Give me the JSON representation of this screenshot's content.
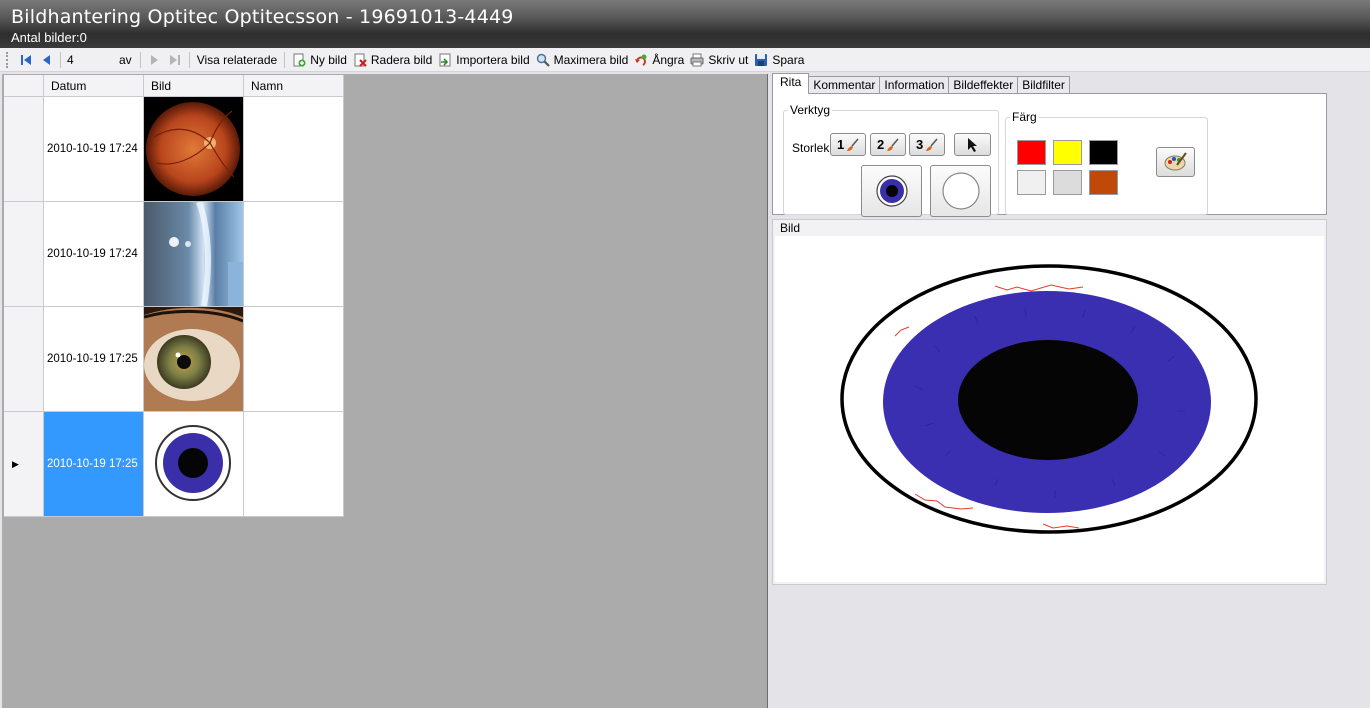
{
  "window": {
    "title": "Bildhantering Optitec Optitecsson - 19691013-4449",
    "subtitle": "Antal bilder:0"
  },
  "toolbar": {
    "position_value": "4",
    "of_label": "av",
    "show_related": "Visa relaterade",
    "new_image": "Ny bild",
    "delete_image": "Radera bild",
    "import_image": "Importera bild",
    "maximize_image": "Maximera bild",
    "undo": "Ångra",
    "print": "Skriv ut",
    "save": "Spara"
  },
  "grid": {
    "columns": [
      "Datum",
      "Bild",
      "Namn"
    ],
    "rows": [
      {
        "date": "2010-10-19 17:24",
        "image": "fundus-photo",
        "name": ""
      },
      {
        "date": "2010-10-19 17:24",
        "image": "slit-lamp-photo",
        "name": ""
      },
      {
        "date": "2010-10-19 17:25",
        "image": "eye-closeup-photo",
        "name": ""
      },
      {
        "date": "2010-10-19 17:25",
        "image": "eye-drawing",
        "name": "",
        "selected": true
      }
    ]
  },
  "tabs": [
    "Rita",
    "Kommentar",
    "Information",
    "Bildeffekter",
    "Bildfilter"
  ],
  "draw_tab": {
    "tools_legend": "Verktyg",
    "size_label": "Storlek",
    "size_buttons": [
      "1",
      "2",
      "3"
    ],
    "color_legend": "Färg",
    "colors": [
      "#ff0000",
      "#ffff00",
      "#000000",
      "#f0f0f0",
      "#dcdcdc",
      "#c04808"
    ]
  },
  "image_panel": {
    "label": "Bild"
  }
}
